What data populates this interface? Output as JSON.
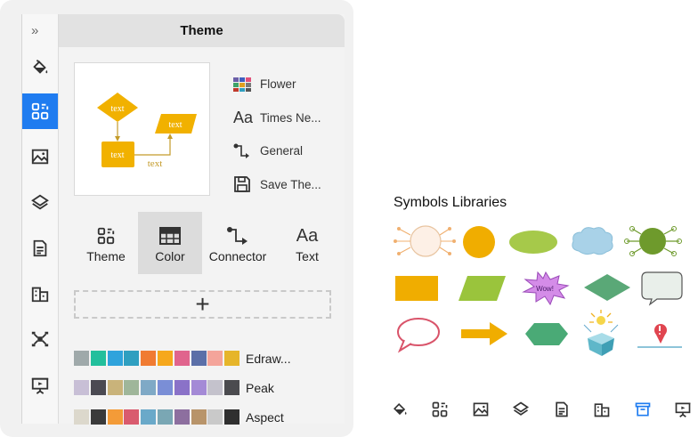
{
  "panel": {
    "title": "Theme",
    "expand_glyph": "»",
    "rail_icons": [
      "paint-bucket-icon",
      "theme-grid-icon",
      "image-icon",
      "layers-icon",
      "document-icon",
      "buildings-icon",
      "mindmap-icon",
      "presentation-icon"
    ],
    "rail_active": "theme-grid-icon",
    "preview": {
      "node_top": "text",
      "node_right": "text",
      "node_bottom": "text",
      "edge_label": "text"
    },
    "settings": [
      {
        "label": "Flower",
        "icon": "color-grid-icon"
      },
      {
        "label": "Times Ne...",
        "icon": "font-aa-icon"
      },
      {
        "label": "General",
        "icon": "connector-icon"
      },
      {
        "label": "Save The...",
        "icon": "save-icon"
      }
    ],
    "tabs": [
      {
        "label": "Theme",
        "icon": "theme-grid-icon",
        "icon_glyph": "",
        "active": false
      },
      {
        "label": "Color",
        "icon": "color-table-icon",
        "icon_glyph": "",
        "active": true
      },
      {
        "label": "Connector",
        "icon": "connector-icon",
        "icon_glyph": "",
        "active": false
      },
      {
        "label": "Text",
        "icon": "font-aa-icon",
        "icon_glyph": "Aa",
        "active": false
      }
    ],
    "add_glyph": "+",
    "palettes": [
      {
        "name": "Edraw...",
        "colors": [
          "#9fa9aa",
          "#22bf9c",
          "#2fa3dc",
          "#2f9fc0",
          "#f07b32",
          "#f6a81c",
          "#e0648d",
          "#5b6fa8",
          "#f4a49a",
          "#e6b52a"
        ]
      },
      {
        "name": "Peak",
        "colors": [
          "#c8bfd6",
          "#4b4a52",
          "#c9b37a",
          "#9fb69a",
          "#7fa9c6",
          "#7a8ed6",
          "#8a72c8",
          "#a48ad6",
          "#c4c2cc",
          "#4b4b4f"
        ]
      },
      {
        "name": "Aspect",
        "colors": [
          "#dcd8cc",
          "#3a3a3a",
          "#f39b38",
          "#d95b6e",
          "#6aa9c9",
          "#7aa7b4",
          "#8d6f9f",
          "#b8946a",
          "#c9c9c9",
          "#2f2f2f"
        ]
      }
    ],
    "colors": {
      "accent": "#1f7cf0",
      "node": "#f1b100"
    }
  },
  "symbols": {
    "title": "Symbols Libraries",
    "burst_text": "Wow!",
    "items": [
      "circle-rays-symbol",
      "orange-circle-symbol",
      "green-ellipse-symbol",
      "cloud-symbol",
      "green-circle-rays-symbol",
      "orange-rectangle-symbol",
      "green-parallelogram-symbol",
      "wow-burst-symbol",
      "green-diamond-symbol",
      "speech-bubble-rect-symbol",
      "speech-bubble-round-symbol",
      "arrow-right-symbol",
      "green-hexagon-symbol",
      "gift-box-symbol",
      "map-pin-symbol"
    ],
    "bottom_icons": [
      "paint-bucket-icon",
      "theme-grid-icon",
      "image-icon",
      "layers-icon",
      "document-icon",
      "buildings-icon",
      "library-icon",
      "presentation-icon"
    ],
    "bottom_active": "library-icon"
  }
}
